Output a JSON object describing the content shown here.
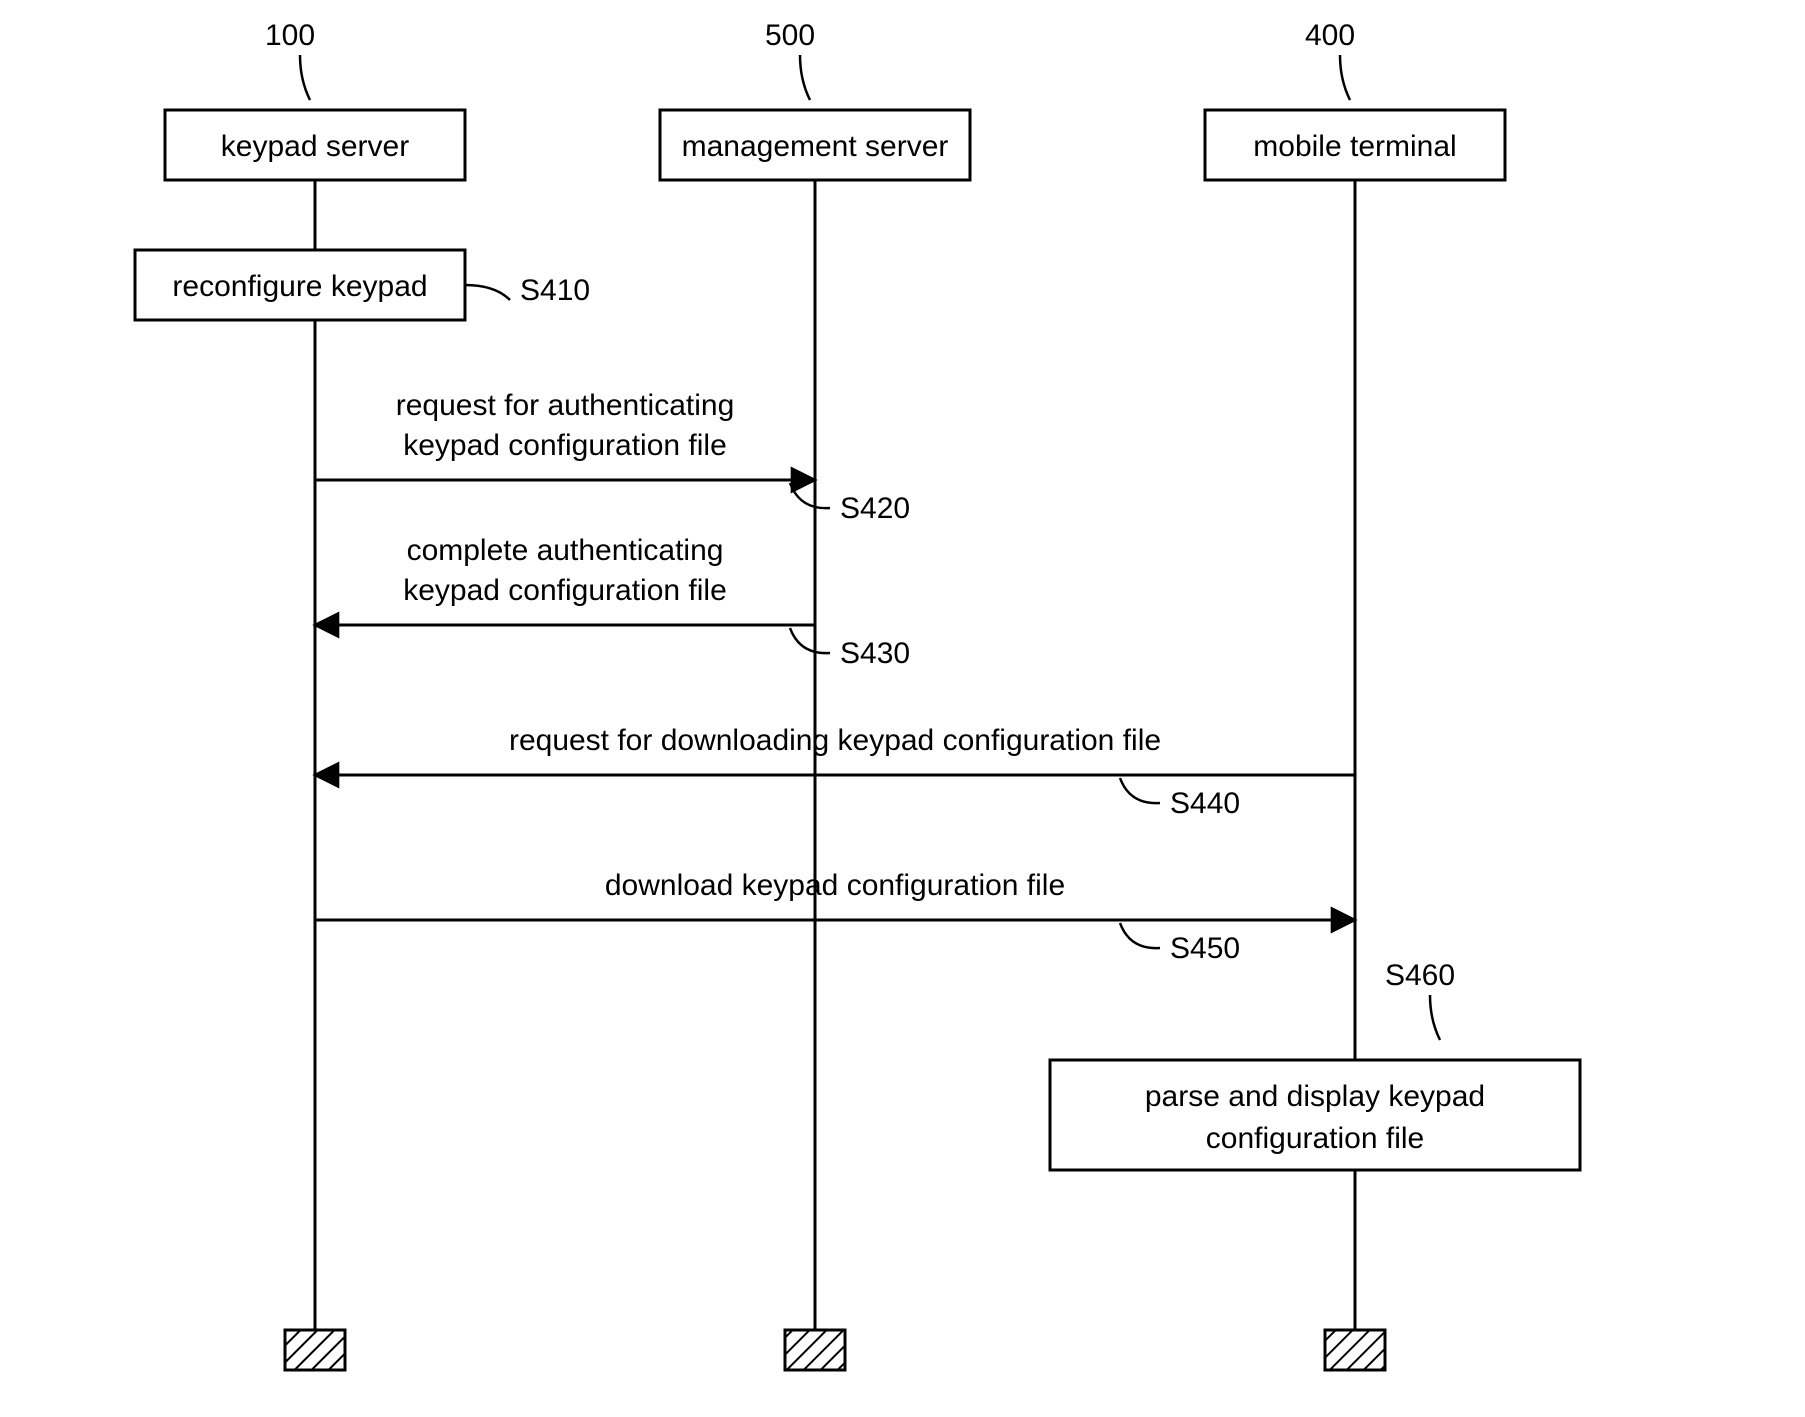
{
  "lifelines": {
    "keypad": {
      "ref": "100",
      "label": "keypad server"
    },
    "mgmt": {
      "ref": "500",
      "label": "management server"
    },
    "terminal": {
      "ref": "400",
      "label": "mobile terminal"
    }
  },
  "steps": {
    "s410": {
      "ref": "S410",
      "label": "reconfigure keypad"
    },
    "s420": {
      "ref": "S420",
      "line1": "request for authenticating",
      "line2": "keypad configuration file"
    },
    "s430": {
      "ref": "S430",
      "line1": "complete authenticating",
      "line2": "keypad configuration file"
    },
    "s440": {
      "ref": "S440",
      "label": "request for downloading keypad configuration file"
    },
    "s450": {
      "ref": "S450",
      "label": "download keypad configuration file"
    },
    "s460": {
      "ref": "S460",
      "line1": "parse and display keypad",
      "line2": "configuration file"
    }
  }
}
